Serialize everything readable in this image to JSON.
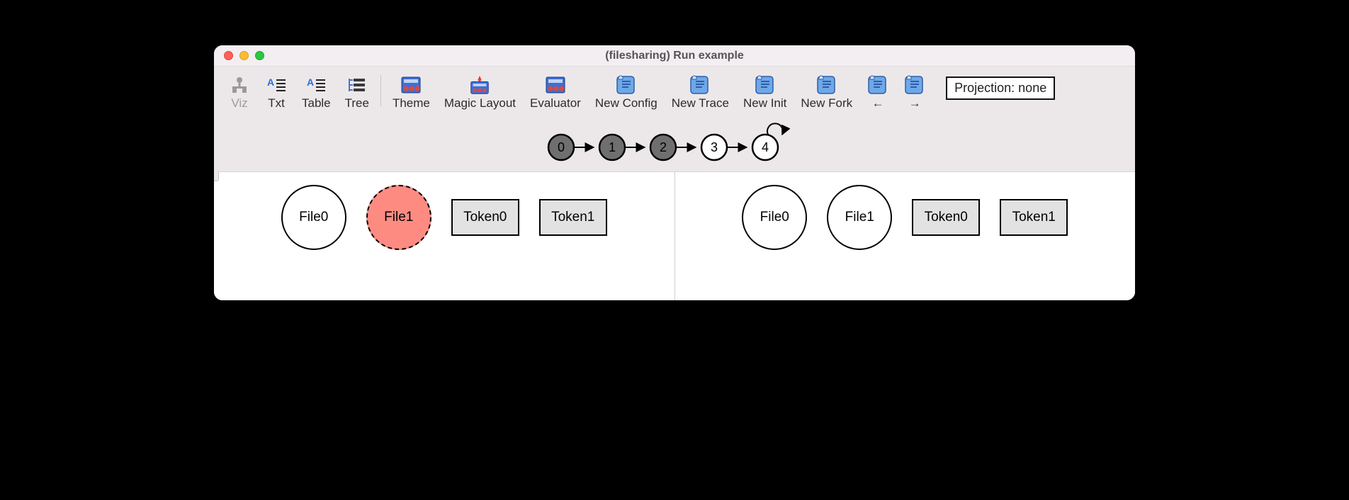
{
  "window": {
    "title": "(filesharing) Run example"
  },
  "toolbar": {
    "viz": "Viz",
    "txt": "Txt",
    "table": "Table",
    "tree": "Tree",
    "theme": "Theme",
    "magic": "Magic Layout",
    "eval": "Evaluator",
    "newcfg": "New Config",
    "newtrace": "New Trace",
    "newinit": "New Init",
    "newfork": "New Fork",
    "back": "←",
    "forward": "→"
  },
  "projection": {
    "label": "Projection: none"
  },
  "trace": {
    "states": [
      "0",
      "1",
      "2",
      "3",
      "4"
    ],
    "current_index": 3,
    "loop_back_from": 4,
    "loop_back_to": 4
  },
  "panes": [
    {
      "nodes": [
        {
          "label": "File0",
          "shape": "circle",
          "style": "normal"
        },
        {
          "label": "File1",
          "shape": "circle",
          "style": "trashed"
        },
        {
          "label": "Token0",
          "shape": "box",
          "style": "normal"
        },
        {
          "label": "Token1",
          "shape": "box",
          "style": "normal"
        }
      ]
    },
    {
      "nodes": [
        {
          "label": "File0",
          "shape": "circle",
          "style": "normal"
        },
        {
          "label": "File1",
          "shape": "circle",
          "style": "normal"
        },
        {
          "label": "Token0",
          "shape": "box",
          "style": "normal"
        },
        {
          "label": "Token1",
          "shape": "box",
          "style": "normal"
        }
      ]
    }
  ]
}
